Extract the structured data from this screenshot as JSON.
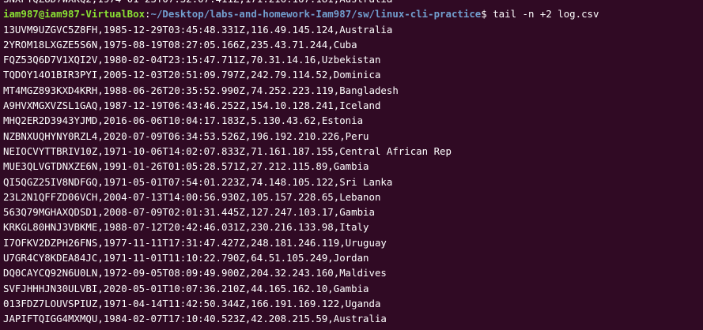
{
  "terminal": {
    "partial_top_line": "SNXPYQZ8D7WXKQ2,1974-01-23T07:32:07.411Z,171.216.167.181,Australia",
    "prompt": {
      "user_host": "iam987@iam987-VirtualBox",
      "separator": ":",
      "path": "~/Desktop/labs-and-homework-Iam987/sw/linux-cli-practice",
      "symbol": "$ ",
      "command": "tail -n +2 log.csv"
    },
    "output_lines": [
      "13UVM9UZGVC5Z8FH,1985-12-29T03:45:48.331Z,116.49.145.124,Australia",
      "2YROM18LXGZE5S6N,1975-08-19T08:27:05.166Z,235.43.71.244,Cuba",
      "FQZ53Q6D7V1XQI2V,1980-02-04T23:15:47.711Z,70.31.14.16,Uzbekistan",
      "TQDOY14O1BIR3PYI,2005-12-03T20:51:09.797Z,242.79.114.52,Dominica",
      "MT4MGZ893KXD4KRH,1988-06-26T20:35:52.990Z,74.252.223.119,Bangladesh",
      "A9HVXMGXVZSL1GAQ,1987-12-19T06:43:46.252Z,154.10.128.241,Iceland",
      "MHQ2ER2D3943YJMD,2016-06-06T10:04:17.183Z,5.130.43.62,Estonia",
      "NZBNXUQHYNY0RZL4,2020-07-09T06:34:53.526Z,196.192.210.226,Peru",
      "NEIOCVYTTBRIV10Z,1971-10-06T14:02:07.833Z,71.161.187.155,Central African Rep",
      "MUE3QLVGTDNXZE6N,1991-01-26T01:05:28.571Z,27.212.115.89,Gambia",
      "QI5QGZ25IV8NDFGQ,1971-05-01T07:54:01.223Z,74.148.105.122,Sri Lanka",
      "23L2N1QFFZD06VCH,2004-07-13T14:00:56.930Z,105.157.228.65,Lebanon",
      "563Q79MGHAXQDSD1,2008-07-09T02:01:31.445Z,127.247.103.17,Gambia",
      "KRKGL80HNJ3VBKME,1988-07-12T20:42:46.031Z,230.216.133.98,Italy",
      "I7OFKV2DZPH26FNS,1977-11-11T17:31:47.427Z,248.181.246.119,Uruguay",
      "U7GR4CY8KDEA84JC,1971-11-01T11:10:22.790Z,64.51.105.249,Jordan",
      "DQ0CAYCQ92N6U0LN,1972-09-05T08:09:49.900Z,204.32.243.160,Maldives",
      "SVFJHHHJN30ULVBI,2020-05-01T10:07:36.210Z,44.165.162.10,Gambia",
      "013FDZ7LOUVSPIUZ,1971-04-14T11:42:50.344Z,166.191.169.122,Uganda",
      "JAPIFTQIGG4MXMQU,1984-02-07T17:10:40.523Z,42.208.215.59,Australia"
    ],
    "colors": {
      "background": "#300a24",
      "text": "#ffffff",
      "prompt_user": "#8ae234",
      "prompt_path": "#729fcf"
    }
  }
}
